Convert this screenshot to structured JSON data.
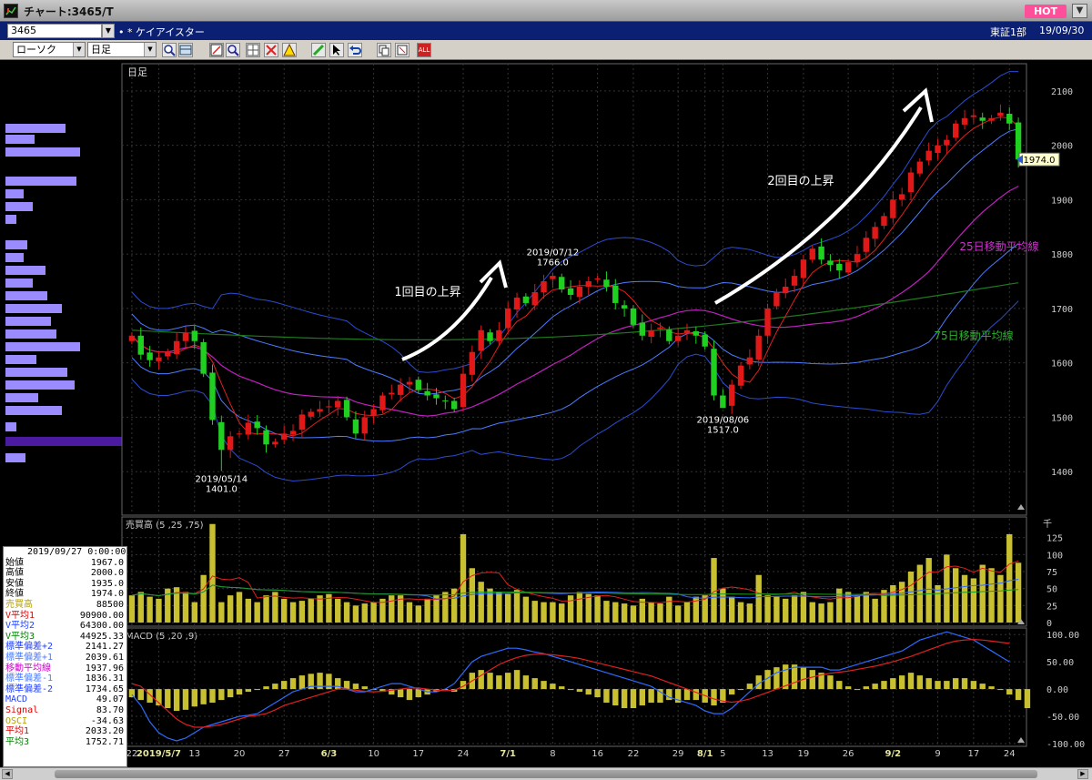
{
  "window": {
    "title": "チャート:3465/T",
    "hot": "HOT"
  },
  "header": {
    "code": "3465",
    "stock_name": "• * ケイアイスター",
    "market": "東証1部",
    "date": "19/09/30"
  },
  "toolbar": {
    "chart_style": "ローソク",
    "period": "日足"
  },
  "info": [
    {
      "label": "2019/09/27 0:00:00",
      "value": "",
      "color": "#000000"
    },
    {
      "label": "始値",
      "value": "1967.0",
      "color": "#000000"
    },
    {
      "label": "高値",
      "value": "2000.0",
      "color": "#000000"
    },
    {
      "label": "安値",
      "value": "1935.0",
      "color": "#000000"
    },
    {
      "label": "終値",
      "value": "1974.0",
      "color": "#000000"
    },
    {
      "label": "売買高",
      "value": "88500",
      "color": "#b5a300"
    },
    {
      "label": "V平均1",
      "value": "90900.00",
      "color": "#e00000"
    },
    {
      "label": "V平均2",
      "value": "64300.00",
      "color": "#2040ff"
    },
    {
      "label": "V平均3",
      "value": "44925.33",
      "color": "#008000"
    },
    {
      "label": "標準偏差+2",
      "value": "2141.27",
      "color": "#2040ff"
    },
    {
      "label": "標準偏差+1",
      "value": "2039.61",
      "color": "#4c7cff"
    },
    {
      "label": "移動平均線",
      "value": "1937.96",
      "color": "#d000d0"
    },
    {
      "label": "標準偏差-1",
      "value": "1836.31",
      "color": "#4c7cff"
    },
    {
      "label": "標準偏差-2",
      "value": "1734.65",
      "color": "#2040ff"
    },
    {
      "label": "MACD",
      "value": "49.07",
      "color": "#2040ff"
    },
    {
      "label": "Signal",
      "value": "83.70",
      "color": "#e00000"
    },
    {
      "label": "OSCI",
      "value": "-34.63",
      "color": "#b5a300"
    },
    {
      "label": "平均1",
      "value": "2033.20",
      "color": "#e00000"
    },
    {
      "label": "平均3",
      "value": "1752.71",
      "color": "#008000"
    }
  ],
  "chart_data": {
    "type": "candlestick",
    "period_label": "日足",
    "price_axis": {
      "range": [
        1320,
        2150
      ],
      "ticks": [
        "2100",
        "2000",
        "1900",
        "1800",
        "1700",
        "1600",
        "1500",
        "1400"
      ]
    },
    "x_ticks": [
      {
        "label": "22",
        "i": 0
      },
      {
        "label": "2019/5/7",
        "i": 3,
        "major": true
      },
      {
        "label": "13",
        "i": 7
      },
      {
        "label": "20",
        "i": 12
      },
      {
        "label": "27",
        "i": 17
      },
      {
        "label": "6/3",
        "i": 22,
        "major": true
      },
      {
        "label": "10",
        "i": 27
      },
      {
        "label": "17",
        "i": 32
      },
      {
        "label": "24",
        "i": 37
      },
      {
        "label": "7/1",
        "i": 42,
        "major": true
      },
      {
        "label": "8",
        "i": 47
      },
      {
        "label": "16",
        "i": 52
      },
      {
        "label": "22",
        "i": 56
      },
      {
        "label": "29",
        "i": 61
      },
      {
        "label": "8/1",
        "i": 64,
        "major": true
      },
      {
        "label": "5",
        "i": 66
      },
      {
        "label": "13",
        "i": 71
      },
      {
        "label": "19",
        "i": 75
      },
      {
        "label": "26",
        "i": 80
      },
      {
        "label": "9/2",
        "i": 85,
        "major": true
      },
      {
        "label": "9",
        "i": 90
      },
      {
        "label": "17",
        "i": 94
      },
      {
        "label": "24",
        "i": 98
      }
    ],
    "closes": [
      1650,
      1615,
      1605,
      1610,
      1620,
      1640,
      1655,
      1640,
      1580,
      1495,
      1440,
      1465,
      1470,
      1490,
      1480,
      1450,
      1455,
      1470,
      1475,
      1505,
      1510,
      1515,
      1520,
      1530,
      1500,
      1470,
      1500,
      1515,
      1540,
      1545,
      1560,
      1565,
      1550,
      1540,
      1535,
      1530,
      1515,
      1580,
      1620,
      1660,
      1640,
      1660,
      1700,
      1720,
      1710,
      1730,
      1750,
      1760,
      1735,
      1725,
      1740,
      1750,
      1755,
      1740,
      1710,
      1700,
      1670,
      1650,
      1660,
      1665,
      1640,
      1650,
      1660,
      1650,
      1630,
      1540,
      1517,
      1560,
      1595,
      1610,
      1650,
      1700,
      1730,
      1740,
      1760,
      1790,
      1810,
      1790,
      1780,
      1770,
      1785,
      1800,
      1830,
      1850,
      1870,
      1900,
      1910,
      1950,
      1970,
      1990,
      2000,
      2010,
      2040,
      2050,
      2055,
      2045,
      2050,
      2060,
      2040,
      1974
    ],
    "annotations": [
      {
        "text": "2019/05/14",
        "i": 10
      },
      {
        "text": "1401.0",
        "i": 10
      },
      {
        "text": "2019/07/12",
        "i": 47
      },
      {
        "text": "1766.0",
        "i": 47
      },
      {
        "text": "2019/08/06",
        "i": 66
      },
      {
        "text": "1517.0",
        "i": 66
      },
      {
        "text": "1回目の上昇"
      },
      {
        "text": "2回目の上昇"
      },
      {
        "text": "25日移動平均線"
      },
      {
        "text": "75日移動平均線"
      },
      {
        "text": "1974.0"
      }
    ],
    "volume": {
      "title": "売買高 (5 ,25 ,75)",
      "unit": "千",
      "ticks": [
        "125",
        "100",
        "75",
        "50",
        "25",
        "0"
      ],
      "max": 150,
      "values": [
        40,
        45,
        38,
        35,
        50,
        52,
        45,
        30,
        70,
        145,
        30,
        40,
        45,
        35,
        30,
        40,
        45,
        35,
        30,
        32,
        35,
        40,
        42,
        35,
        30,
        25,
        28,
        30,
        35,
        40,
        40,
        30,
        25,
        35,
        40,
        45,
        50,
        130,
        80,
        60,
        50,
        45,
        42,
        48,
        38,
        32,
        30,
        30,
        28,
        40,
        45,
        42,
        40,
        32,
        30,
        28,
        25,
        35,
        30,
        28,
        38,
        25,
        30,
        38,
        40,
        95,
        50,
        38,
        30,
        28,
        70,
        40,
        38,
        35,
        40,
        45,
        30,
        28,
        30,
        50,
        45,
        40,
        45,
        35,
        48,
        55,
        60,
        75,
        85,
        95,
        55,
        100,
        80,
        70,
        65,
        85,
        80,
        70,
        130,
        88
      ]
    },
    "macd": {
      "title": "MACD (5 ,20 ,9)",
      "ticks": [
        "100.00",
        "50.00",
        "0.00",
        "-50.00",
        "-100.00"
      ],
      "range": [
        -105,
        112
      ],
      "osci": [
        -15,
        -20,
        -25,
        -30,
        -35,
        -40,
        -38,
        -32,
        -28,
        -25,
        -20,
        -15,
        -10,
        -5,
        0,
        5,
        10,
        15,
        20,
        25,
        28,
        30,
        28,
        20,
        15,
        10,
        5,
        0,
        -5,
        -10,
        -15,
        -20,
        -15,
        -10,
        -5,
        0,
        -5,
        15,
        30,
        35,
        30,
        25,
        30,
        35,
        25,
        20,
        15,
        10,
        5,
        0,
        -5,
        -10,
        -15,
        -25,
        -30,
        -35,
        -35,
        -30,
        -25,
        -25,
        -20,
        -25,
        -20,
        -20,
        -25,
        -30,
        -25,
        -10,
        0,
        10,
        25,
        35,
        40,
        45,
        45,
        40,
        35,
        30,
        25,
        15,
        5,
        0,
        5,
        10,
        15,
        20,
        25,
        30,
        25,
        20,
        15,
        15,
        20,
        20,
        15,
        10,
        5,
        0,
        -10,
        -20,
        -35
      ],
      "macd_line": [
        -10,
        -30,
        -60,
        -80,
        -90,
        -95,
        -90,
        -80,
        -70,
        -65,
        -60,
        -55,
        -50,
        -48,
        -45,
        -35,
        -25,
        -15,
        -5,
        0,
        5,
        5,
        5,
        5,
        0,
        -5,
        -5,
        0,
        5,
        10,
        10,
        5,
        0,
        -5,
        -5,
        0,
        10,
        30,
        50,
        60,
        65,
        70,
        75,
        75,
        72,
        68,
        65,
        60,
        55,
        50,
        45,
        40,
        35,
        30,
        25,
        20,
        15,
        10,
        5,
        -5,
        -15,
        -20,
        -25,
        -30,
        -40,
        -45,
        -45,
        -35,
        -20,
        -5,
        10,
        20,
        30,
        35,
        40,
        40,
        40,
        40,
        35,
        35,
        40,
        45,
        50,
        55,
        60,
        65,
        70,
        80,
        90,
        95,
        100,
        105,
        100,
        95,
        90,
        80,
        70,
        60,
        50
      ],
      "signal_line": [
        10,
        5,
        -10,
        -25,
        -40,
        -55,
        -65,
        -70,
        -70,
        -68,
        -65,
        -60,
        -55,
        -50,
        -48,
        -45,
        -38,
        -30,
        -25,
        -20,
        -15,
        -10,
        -5,
        0,
        0,
        -2,
        -4,
        -5,
        -4,
        -2,
        0,
        2,
        2,
        0,
        -2,
        -3,
        -2,
        5,
        15,
        25,
        35,
        45,
        52,
        58,
        62,
        64,
        64,
        63,
        61,
        59,
        56,
        52,
        48,
        44,
        40,
        36,
        32,
        28,
        24,
        18,
        12,
        6,
        0,
        -6,
        -12,
        -18,
        -22,
        -24,
        -22,
        -18,
        -12,
        -6,
        0,
        6,
        12,
        18,
        22,
        26,
        29,
        31,
        33,
        36,
        39,
        42,
        46,
        50,
        55,
        60,
        66,
        72,
        78,
        84,
        88,
        90,
        91,
        90,
        88,
        86,
        84
      ]
    }
  }
}
